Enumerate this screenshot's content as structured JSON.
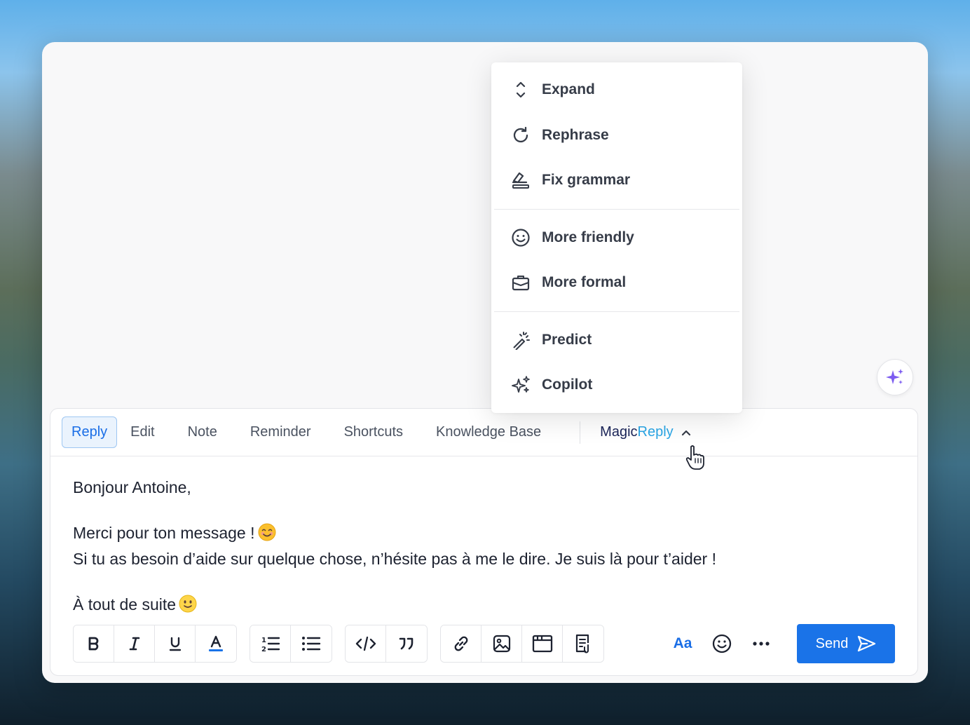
{
  "tabs": [
    {
      "label": "Reply",
      "active": true
    },
    {
      "label": "Edit",
      "active": false
    },
    {
      "label": "Note",
      "active": false
    },
    {
      "label": "Reminder",
      "active": false
    },
    {
      "label": "Shortcuts",
      "active": false
    },
    {
      "label": "Knowledge Base",
      "active": false
    }
  ],
  "magic_reply": {
    "label_part1": "Magic",
    "label_part2": "Reply",
    "icon": "chevron-up-icon"
  },
  "menu": {
    "items": [
      {
        "label": "Expand",
        "icon": "expand-icon"
      },
      {
        "label": "Rephrase",
        "icon": "rephrase-icon"
      },
      {
        "label": "Fix grammar",
        "icon": "eraser-icon"
      },
      {
        "label": "More friendly",
        "icon": "smiley-icon"
      },
      {
        "label": "More formal",
        "icon": "briefcase-icon"
      },
      {
        "label": "Predict",
        "icon": "magic-wand-icon"
      },
      {
        "label": "Copilot",
        "icon": "sparkles-icon"
      }
    ]
  },
  "editor": {
    "line1": "Bonjour Antoine,",
    "line2": "Merci pour ton message !",
    "line3": "Si tu as besoin d’aide sur quelque chose, n’hésite pas à me le dire. Je suis là pour t’aider !",
    "line4": "À tout de suite"
  },
  "toolbar": {
    "font_label": "Aa",
    "send_label": "Send"
  },
  "colors": {
    "accent": "#1a73e8",
    "active_tab_bg": "#eaf3fd",
    "magic_dark": "#1b2559",
    "magic_light": "#2aa6e6",
    "sparkle": "#8b5cf6"
  }
}
